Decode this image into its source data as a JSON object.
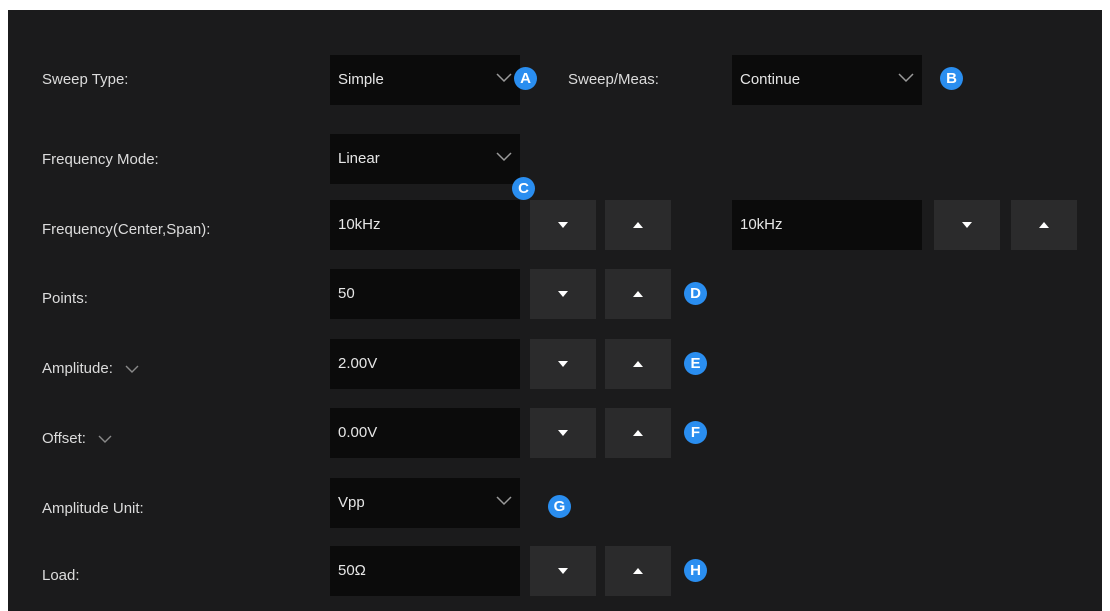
{
  "colors": {
    "panel_bg": "#1b1b1c",
    "field_bg": "#0b0b0b",
    "button_bg": "#2b2b2c",
    "marker": "#2a8ef0",
    "text": "#dcdcdc"
  },
  "icons": {
    "dropdown": "chevron-down-icon",
    "decrement": "triangle-down-icon",
    "increment": "triangle-up-icon"
  },
  "sweep_type": {
    "label": "Sweep Type:",
    "value": "Simple",
    "marker": "A"
  },
  "sweep_meas": {
    "label": "Sweep/Meas:",
    "value": "Continue",
    "marker": "B"
  },
  "frequency_mode": {
    "label": "Frequency Mode:",
    "value": "Linear",
    "marker": "C"
  },
  "frequency": {
    "label": "Frequency(Center,Span):",
    "center": "10kHz",
    "span": "10kHz"
  },
  "points": {
    "label": "Points:",
    "value": "50",
    "marker": "D"
  },
  "amplitude": {
    "label": "Amplitude:",
    "value": "2.00V",
    "marker": "E"
  },
  "offset": {
    "label": "Offset:",
    "value": "0.00V",
    "marker": "F"
  },
  "amplitude_unit": {
    "label": "Amplitude Unit:",
    "value": "Vpp",
    "marker": "G"
  },
  "load": {
    "label": "Load:",
    "value": "50Ω",
    "marker": "H"
  }
}
